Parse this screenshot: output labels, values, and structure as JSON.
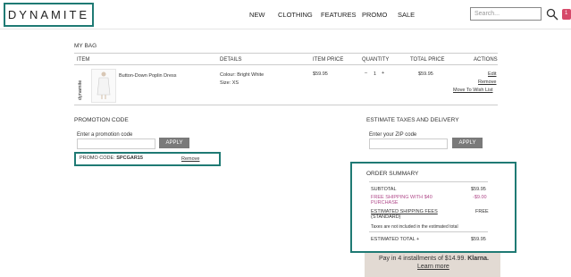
{
  "header": {
    "logo": "DYNAMITE",
    "nav": [
      "NEW",
      "CLOTHING",
      "FEATURES",
      "PROMO",
      "SALE"
    ],
    "search_placeholder": "Search...",
    "cart_count": "1"
  },
  "bag": {
    "title": "MY BAG",
    "columns": {
      "item": "ITEM",
      "details": "DETAILS",
      "item_price": "ITEM PRICE",
      "quantity": "QUANTITY",
      "total_price": "TOTAL PRICE",
      "actions": "ACTIONS"
    },
    "product": {
      "brand_vertical": "dynamite",
      "name": "Button-Down Poplin Dress",
      "colour": "Colour: Bright White",
      "size": "Size: XS",
      "item_price": "$59.95",
      "qty_minus": "–",
      "qty": "1",
      "qty_plus": "+",
      "total_price": "$59.95",
      "action_edit": "Edit",
      "action_remove": "Remove",
      "action_wishlist": "Move To Wish List"
    }
  },
  "promo": {
    "title": "PROMOTION CODE",
    "label": "Enter a promotion code",
    "apply": "APPLY",
    "applied_prefix": "PROMO CODE:",
    "applied_code": "SPCGAR15",
    "remove": "Remove"
  },
  "tax": {
    "title": "ESTIMATE TAXES AND DELIVERY",
    "label": "Enter your ZIP code",
    "apply": "APPLY"
  },
  "summary": {
    "title": "ORDER SUMMARY",
    "subtotal_label": "SUBTOTAL",
    "subtotal": "$59.95",
    "free_ship_line1": "FREE SHIPPING WITH $40",
    "free_ship_line2": "PURCHASE",
    "free_ship_value": "-$9.00",
    "est_ship_label": "ESTIMATED SHIPPING FEES",
    "est_ship_sub": "(STANDARD)",
    "est_ship_value": "FREE",
    "tax_note": "Taxes are not included in the estimated total",
    "total_label": "ESTIMATED TOTAL +",
    "total": "$59.95"
  },
  "klarna": {
    "text": "Pay in 4 installments of $14.99.",
    "brand": "Klarna.",
    "link": "Learn more"
  }
}
